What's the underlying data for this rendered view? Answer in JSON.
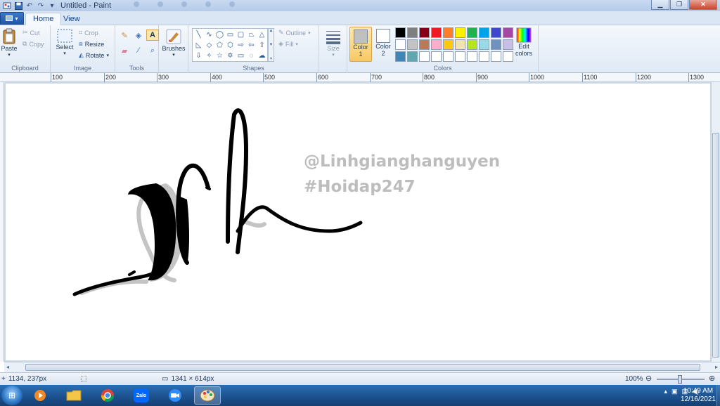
{
  "window": {
    "title": "Untitled - Paint"
  },
  "tabs": [
    {
      "label": "Home"
    },
    {
      "label": "View"
    }
  ],
  "ribbon": {
    "clipboard": {
      "label": "Clipboard",
      "paste": "Paste",
      "cut": "Cut",
      "copy": "Copy"
    },
    "image": {
      "label": "Image",
      "select": "Select",
      "crop": "Crop",
      "resize": "Resize",
      "rotate": "Rotate"
    },
    "tools": {
      "label": "Tools"
    },
    "brushes": {
      "label": "Brushes"
    },
    "shapes": {
      "label": "Shapes",
      "outline": "Outline",
      "fill": "Fill"
    },
    "size": {
      "label": "Size"
    },
    "colors": {
      "label": "Colors",
      "color1": "Color",
      "color1_num": "1",
      "color2": "Color",
      "color2_num": "2",
      "edit": "Edit",
      "edit2": "colors",
      "color1_value": "#c0c0c0",
      "color2_value": "#ffffff",
      "palette": [
        "#000000",
        "#7f7f7f",
        "#880015",
        "#ed1c24",
        "#ff7f27",
        "#fff200",
        "#22b14c",
        "#00a2e8",
        "#3f48cc",
        "#a349a4",
        "#ffffff",
        "#c3c3c3",
        "#b97a57",
        "#ffaec9",
        "#ffc90e",
        "#efe4b0",
        "#b5e61d",
        "#99d9ea",
        "#7092be",
        "#c8bfe7",
        "#3e86b5",
        "#5fa8b0",
        "#ffffff",
        "#ffffff",
        "#ffffff",
        "#ffffff",
        "#ffffff",
        "#ffffff",
        "#ffffff",
        "#ffffff"
      ]
    }
  },
  "ruler": {
    "labels": [
      "100",
      "200",
      "300",
      "400",
      "500",
      "600",
      "700",
      "800",
      "900",
      "1000",
      "1100",
      "1200",
      "1300"
    ]
  },
  "canvas": {
    "watermark_1": "@Linhgianghanguyen",
    "watermark_2": "#Hoidap247"
  },
  "statusbar": {
    "cursor_pos": "1134, 237px",
    "image_size": "1341 × 614px",
    "zoom": "100%"
  },
  "taskbar": {
    "apps": [
      "windows-media-player",
      "file-explorer",
      "chrome",
      "zalo",
      "zoom",
      "paint"
    ],
    "zalo_label": "Zalo",
    "time": "10:49 AM",
    "date": "12/16/2021"
  }
}
